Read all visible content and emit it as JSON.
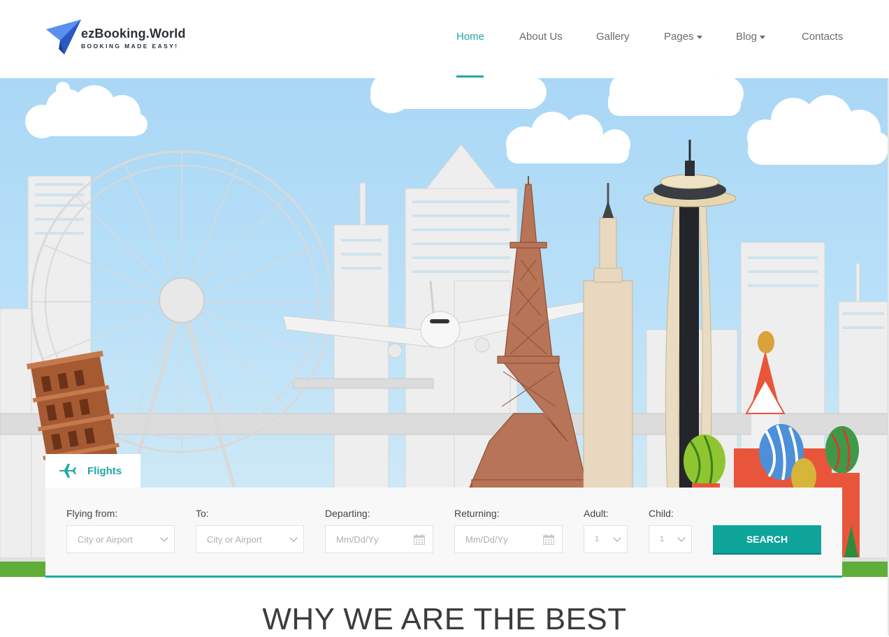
{
  "logo": {
    "name": "ezBooking.World",
    "tagline": "BOOKING MADE EASY!"
  },
  "nav": {
    "items": [
      {
        "label": "Home",
        "active": true
      },
      {
        "label": "About Us"
      },
      {
        "label": "Gallery"
      },
      {
        "label": "Pages",
        "dropdown": true
      },
      {
        "label": "Blog",
        "dropdown": true
      },
      {
        "label": "Contacts"
      }
    ]
  },
  "colors": {
    "accent": "#1fa9a7",
    "button": "#0ea49a"
  },
  "booking": {
    "tab_label": "Flights",
    "tab_icon": "airplane-icon",
    "fields": {
      "from": {
        "label": "Flying from:",
        "placeholder": "City or Airport"
      },
      "to": {
        "label": "To:",
        "placeholder": "City or Airport"
      },
      "departing": {
        "label": "Departing:",
        "placeholder": "Mm/Dd/Yy"
      },
      "returning": {
        "label": "Returning:",
        "placeholder": "Mm/Dd/Yy"
      },
      "adult": {
        "label": "Adult:",
        "value": "1"
      },
      "child": {
        "label": "Child:",
        "value": "1"
      }
    },
    "search_label": "SEARCH"
  },
  "section": {
    "title": "WHY WE ARE THE BEST"
  }
}
